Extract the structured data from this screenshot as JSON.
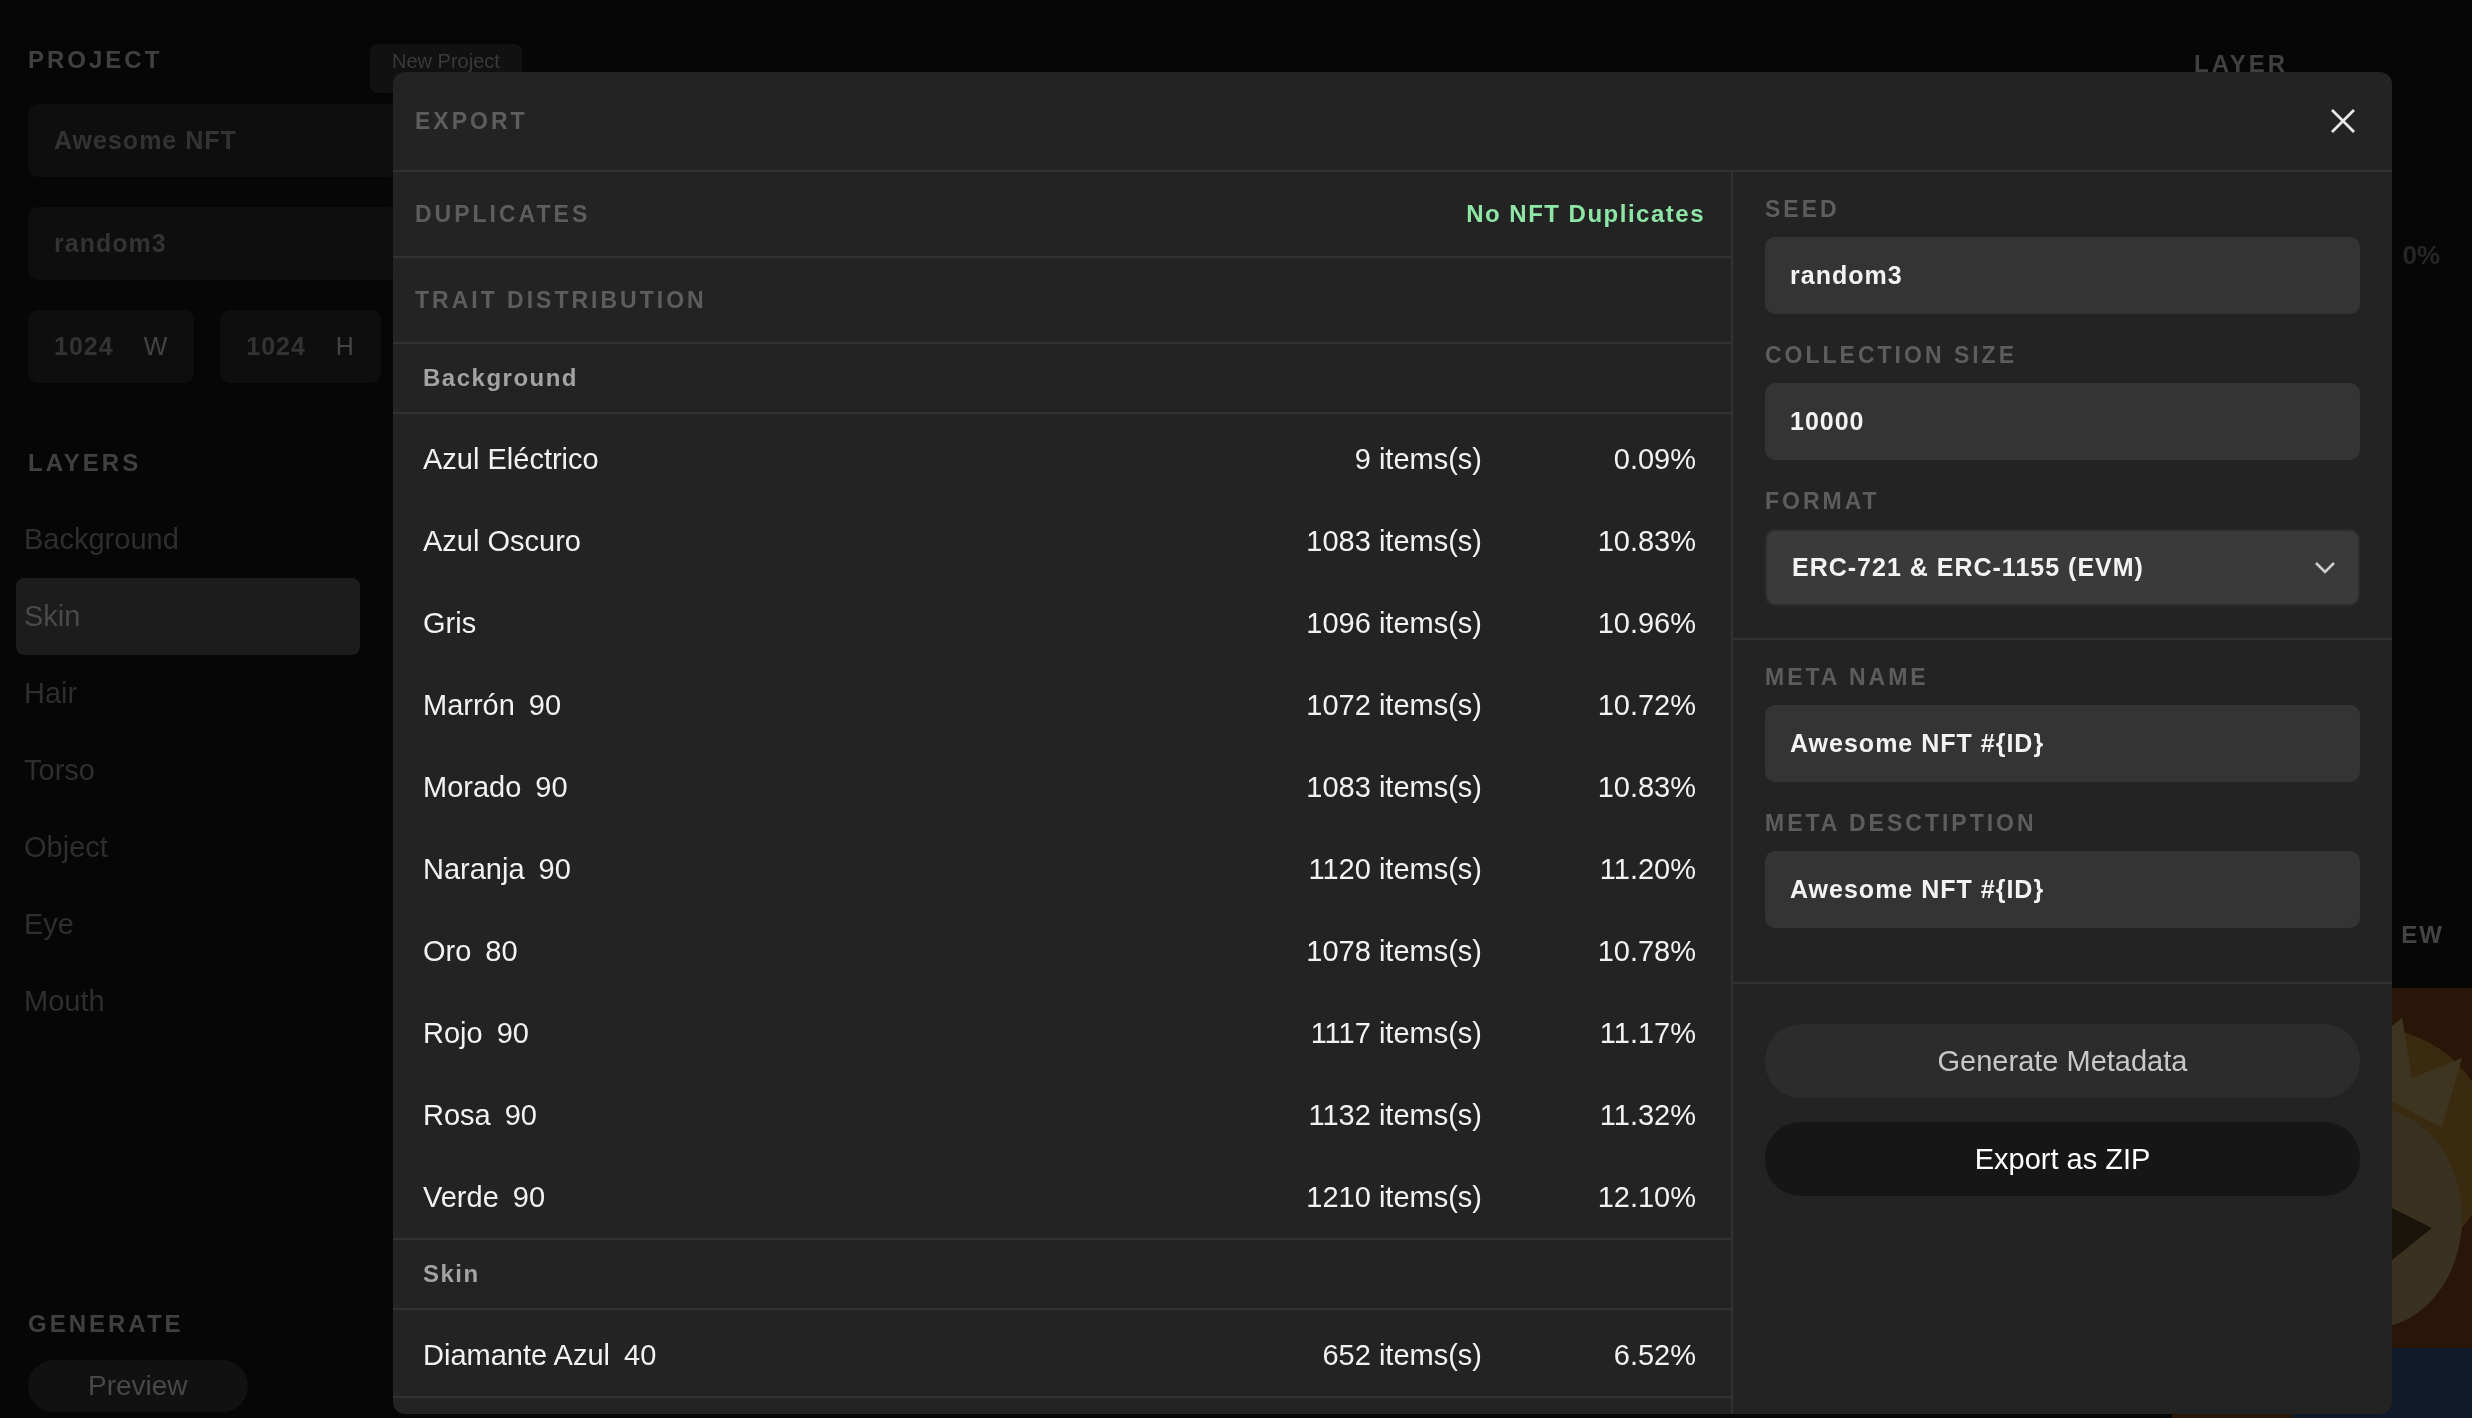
{
  "background_app": {
    "project_label": "PROJECT",
    "new_project_button": "New Project",
    "project_name": "Awesome NFT",
    "seed": "random3",
    "size_fields": [
      {
        "value": "1024",
        "unit": "W"
      },
      {
        "value": "1024",
        "unit": "H"
      }
    ],
    "layers_label": "LAYERS",
    "layers": [
      {
        "name": "Background",
        "selected": false
      },
      {
        "name": "Skin",
        "selected": true
      },
      {
        "name": "Hair",
        "selected": false
      },
      {
        "name": "Torso",
        "selected": false
      },
      {
        "name": "Object",
        "selected": false
      },
      {
        "name": "Eye",
        "selected": false
      },
      {
        "name": "Mouth",
        "selected": false
      }
    ],
    "generate_label": "GENERATE",
    "generate_buttons": [
      "Preview"
    ],
    "layer_label": "LAYER",
    "percent": "0%",
    "preview_label": "EW",
    "preview_image": {
      "kind": "picture"
    }
  },
  "modal": {
    "title": "EXPORT",
    "duplicates": {
      "label": "DUPLICATES",
      "status": "No NFT Duplicates"
    },
    "trait_distribution": {
      "label": "TRAIT DISTRIBUTION",
      "groups": [
        {
          "name": "Background",
          "traits": [
            {
              "name": "Azul Eléctrico",
              "count": "9 items(s)",
              "percent": "0.09%"
            },
            {
              "name": "Azul Oscuro",
              "count": "1083 items(s)",
              "percent": "10.83%"
            },
            {
              "name": "Gris",
              "count": "1096 items(s)",
              "percent": "10.96%"
            },
            {
              "name": "Marrón",
              "weight": "90",
              "count": "1072 items(s)",
              "percent": "10.72%"
            },
            {
              "name": "Morado",
              "weight": "90",
              "count": "1083 items(s)",
              "percent": "10.83%"
            },
            {
              "name": "Naranja",
              "weight": "90",
              "count": "1120 items(s)",
              "percent": "11.20%"
            },
            {
              "name": "Oro",
              "weight": "80",
              "count": "1078 items(s)",
              "percent": "10.78%"
            },
            {
              "name": "Rojo",
              "weight": "90",
              "count": "1117 items(s)",
              "percent": "11.17%"
            },
            {
              "name": "Rosa",
              "weight": "90",
              "count": "1132 items(s)",
              "percent": "11.32%"
            },
            {
              "name": "Verde",
              "weight": "90",
              "count": "1210 items(s)",
              "percent": "12.10%"
            }
          ]
        },
        {
          "name": "Skin",
          "traits": [
            {
              "name": "Diamante Azul",
              "weight": "40",
              "count": "652 items(s)",
              "percent": "6.52%"
            }
          ]
        }
      ]
    },
    "settings": [
      {
        "label": "SEED",
        "value": "random3",
        "kind": "input"
      },
      {
        "label": "COLLECTION SIZE",
        "value": "10000",
        "kind": "input"
      },
      {
        "label": "FORMAT",
        "value": "ERC-721 & ERC-1155 (EVM)",
        "kind": "select"
      }
    ],
    "meta_fields": [
      {
        "label": "META NAME",
        "value": "Awesome NFT #{ID}",
        "kind": "input"
      },
      {
        "label": "META DESCTIPTION",
        "value": "Awesome NFT #{ID}",
        "kind": "input"
      }
    ],
    "actions": [
      {
        "label": "Generate Metadata",
        "kind": "secondary"
      },
      {
        "label": "Export as ZIP",
        "kind": "primary"
      }
    ]
  }
}
